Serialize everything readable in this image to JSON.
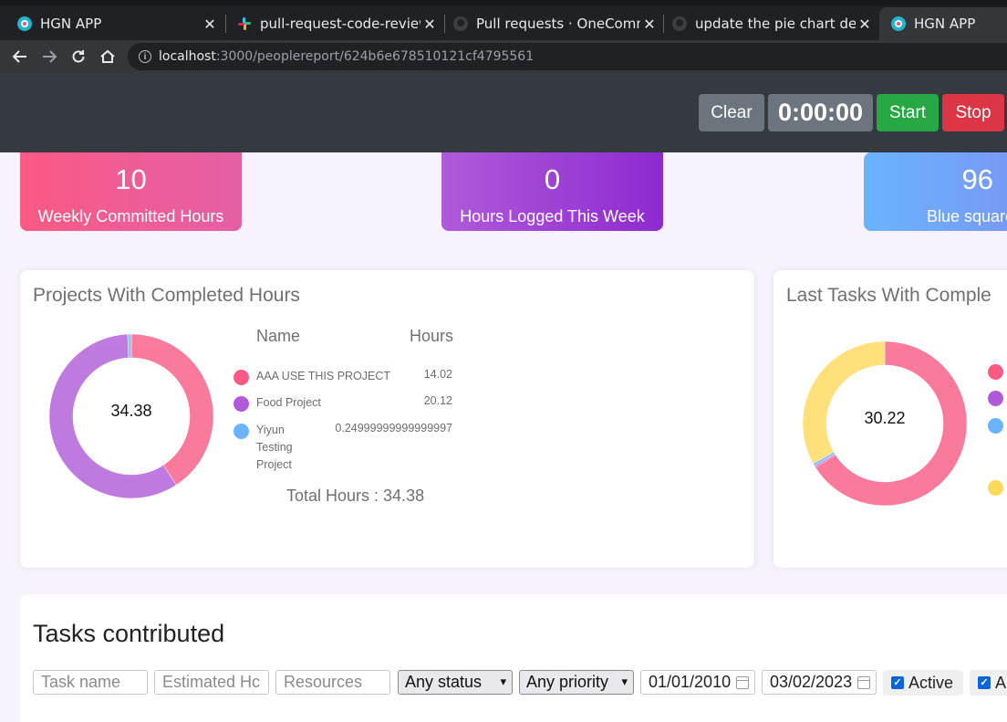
{
  "browser": {
    "tabs": [
      {
        "title": "HGN APP",
        "icon": "hgn-logo-icon"
      },
      {
        "title": "pull-request-code-review",
        "icon": "slack-icon"
      },
      {
        "title": "Pull requests · OneComm",
        "icon": "github-icon"
      },
      {
        "title": "update the pie chart detai",
        "icon": "github-icon"
      },
      {
        "title": "HGN APP",
        "icon": "hgn-logo-icon",
        "active": true
      }
    ],
    "close_glyph": "✕",
    "url_host": "localhost",
    "url_path": ":3000/peoplereport/624b6e678510121cf4795561"
  },
  "header": {
    "clear_label": "Clear",
    "timer": "0:00:00",
    "start_label": "Start",
    "stop_label": "Stop",
    "colors": {
      "bg": "#343a40",
      "secondary": "#6c757d",
      "start": "#28a745",
      "stop": "#dc3545"
    }
  },
  "stats": [
    {
      "value": "10",
      "label": "Weekly Committed Hours"
    },
    {
      "value": "0",
      "label": "Hours Logged This Week"
    },
    {
      "value": "96",
      "label": "Blue square"
    }
  ],
  "projects_panel": {
    "title": "Projects With Completed Hours",
    "center_value": "34.38",
    "name_header": "Name",
    "hours_header": "Hours",
    "items": [
      {
        "name": "AAA USE THIS PROJECT",
        "hours": "14.02",
        "color": "#fa5a84"
      },
      {
        "name": "Food Project",
        "hours": "20.12",
        "color": "#b05ad9"
      },
      {
        "name": "Yiyun Testing Project",
        "hours": "0.24999999999999997",
        "color": "#6ab4ff"
      }
    ],
    "total_label": "Total Hours : 34.38"
  },
  "tasks_panel": {
    "title": "Last Tasks With Comple",
    "center_value": "30.22",
    "legend_colors": [
      "#fa5a84",
      "#b05ad9",
      "#6ab4ff",
      "#ffd95a"
    ]
  },
  "tasks_contributed": {
    "title": "Tasks contributed",
    "task_name_placeholder": "Task name",
    "estimated_placeholder": "Estimated Hc",
    "resources_placeholder": "Resources",
    "status_selected": "Any status",
    "priority_selected": "Any priority",
    "from_date": "01/01/2010",
    "to_date": "03/02/2023",
    "active_label": "Active",
    "second_checkbox_label": "A"
  },
  "chart_data": [
    {
      "type": "pie",
      "title": "Projects With Completed Hours",
      "categories": [
        "AAA USE THIS PROJECT",
        "Food Project",
        "Yiyun Testing Project"
      ],
      "values": [
        14.02,
        20.12,
        0.25
      ],
      "colors": [
        "#fa5a84",
        "#b05ad9",
        "#6ab4ff"
      ]
    },
    {
      "type": "pie",
      "title": "Last Tasks With Comple",
      "values": [
        19.95,
        0.1,
        0.17,
        10.0
      ],
      "colors": [
        "#fa5a84",
        "#b05ad9",
        "#6ab4ff",
        "#ffd95a"
      ]
    }
  ]
}
